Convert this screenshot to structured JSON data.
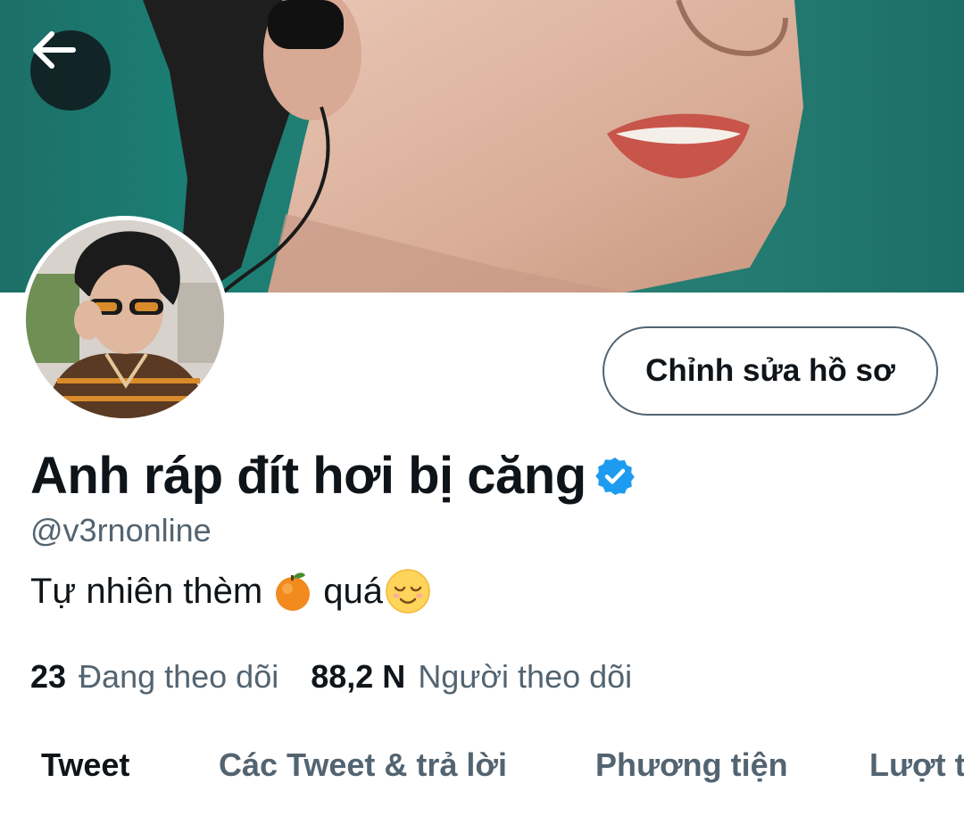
{
  "header": {
    "back_icon": "arrow-left-icon"
  },
  "profile": {
    "edit_button_label": "Chỉnh sửa hồ sơ",
    "display_name": "Anh ráp đít hơi bị căng",
    "verified_icon": "verified-badge-icon",
    "handle": "@v3rnonline",
    "bio_part1": "Tự nhiên thèm",
    "bio_emoji1": "tangerine-emoji",
    "bio_part2": "quá",
    "bio_emoji2": "relieved-face-emoji"
  },
  "stats": {
    "following_count": "23",
    "following_label": "Đang theo dõi",
    "followers_count": "88,2 N",
    "followers_label": "Người theo dõi"
  },
  "tabs": [
    {
      "label": "Tweet",
      "active": true
    },
    {
      "label": "Các Tweet & trả lời",
      "active": false
    },
    {
      "label": "Phương tiện",
      "active": false
    },
    {
      "label": "Lượt thích",
      "active": false
    }
  ],
  "colors": {
    "verified": "#1d9bf0",
    "secondary_text": "#536471",
    "primary_text": "#0f1419"
  }
}
